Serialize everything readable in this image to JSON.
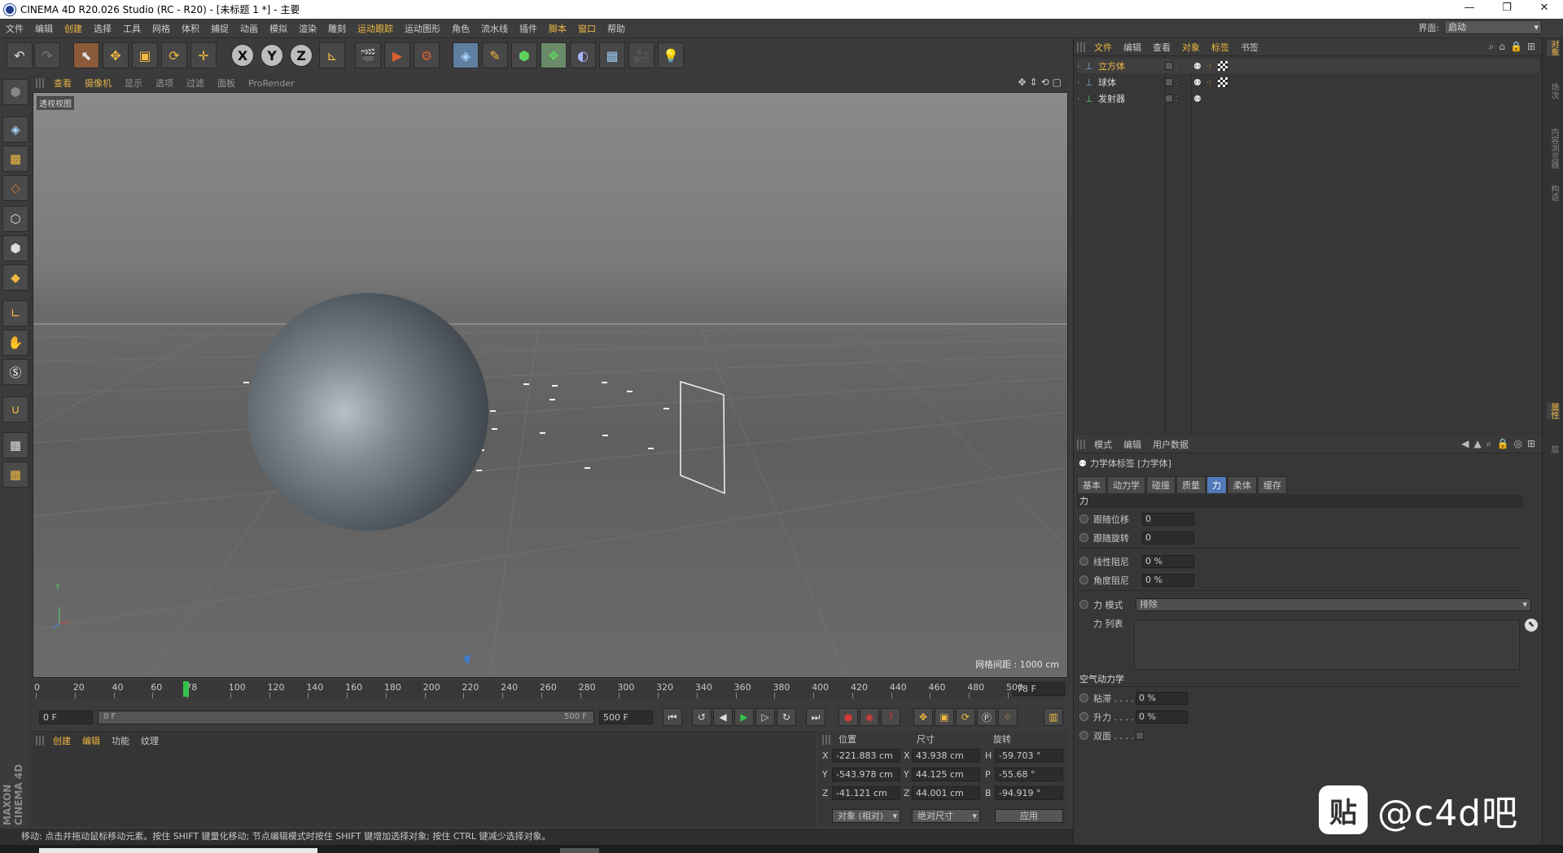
{
  "window": {
    "title": "CINEMA 4D R20.026 Studio (RC - R20) - [未标题 1 *] - 主要",
    "minimize_glyph": "—",
    "restore_glyph": "❐",
    "close_glyph": "✕"
  },
  "menubar": {
    "items": [
      "文件",
      "编辑",
      "创建",
      "选择",
      "工具",
      "网格",
      "体积",
      "捕捉",
      "动画",
      "模拟",
      "渲染",
      "雕刻",
      "运动跟踪",
      "运动图形",
      "角色",
      "流水线",
      "插件",
      "脚本",
      "窗口",
      "帮助"
    ],
    "layout_label": "界面:",
    "layout_value": "启动"
  },
  "toolbar": {
    "icons": [
      "undo-icon",
      "redo-icon",
      "select-icon",
      "move-icon",
      "scale-icon",
      "rotate-icon",
      "live-select-icon",
      "x-axis-icon",
      "y-axis-icon",
      "z-axis-icon",
      "coord-system-icon",
      "render-view-icon",
      "render-picture-queue-icon",
      "render-settings-icon",
      "cube-icon",
      "pen-icon",
      "subdivision-icon",
      "array-icon",
      "deformer-icon",
      "floor-icon",
      "camera-icon",
      "light-icon"
    ],
    "axes": [
      "X",
      "Y",
      "Z"
    ]
  },
  "left_tools": [
    "make-editable-icon",
    "model-mode-icon",
    "texture-mode-icon",
    "workplane-icon",
    "points-mode-icon",
    "edges-mode-icon",
    "polygons-mode-icon",
    "axis-mode-icon",
    "tweak-mode-icon",
    "solo-icon",
    "snap-icon",
    "workplane-lock-icon",
    "layer-icon"
  ],
  "viewport": {
    "menu": [
      "查看",
      "摄像机",
      "显示",
      "选项",
      "过滤",
      "面板",
      "ProRender"
    ],
    "active_menu": [
      "查看",
      "摄像机"
    ],
    "view_label": "透视视图",
    "grid_info": "网格间距 : 1000 cm",
    "axis_y": "Y",
    "nav_icons": [
      "move-view-icon",
      "zoom-view-icon",
      "rotate-view-icon",
      "toggle-view-icon"
    ]
  },
  "timeline": {
    "ticks": [
      "0",
      "20",
      "40",
      "60",
      "78",
      "100",
      "120",
      "140",
      "160",
      "180",
      "200",
      "220",
      "240",
      "260",
      "280",
      "300",
      "320",
      "340",
      "360",
      "380",
      "400",
      "420",
      "440",
      "460",
      "480",
      "500"
    ],
    "current_frame": "78 F",
    "current_frame_value": 78,
    "max_frame": 500
  },
  "playback": {
    "start": "0 F",
    "range_start": "0 F",
    "range_end": "500 F",
    "end": "500 F",
    "buttons": [
      "go-start-icon",
      "prev-key-icon",
      "prev-frame-icon",
      "play-icon",
      "next-frame-icon",
      "next-key-icon",
      "go-end-icon",
      "record-icon",
      "autokey-icon",
      "keyframe-selection-icon",
      "move-key-icon",
      "scale-key-icon",
      "rotate-key-icon",
      "param-key-icon",
      "pla-key-icon",
      "timeline-icon"
    ]
  },
  "materials": {
    "menu": [
      "创建",
      "编辑",
      "功能",
      "纹理"
    ]
  },
  "coords": {
    "headers": [
      "位置",
      "尺寸",
      "旋转"
    ],
    "rows": [
      {
        "axis": "X",
        "pos": "-221.883 cm",
        "size_axis": "X",
        "size": "43.938 cm",
        "rot_axis": "H",
        "rot": "-59.703 °"
      },
      {
        "axis": "Y",
        "pos": "-543.978 cm",
        "size_axis": "Y",
        "size": "44.125 cm",
        "rot_axis": "P",
        "rot": "-55.68 °"
      },
      {
        "axis": "Z",
        "pos": "-41.121 cm",
        "size_axis": "Z",
        "size": "44.001 cm",
        "rot_axis": "B",
        "rot": "-94.919 °"
      }
    ],
    "mode1": "对象 (相对)",
    "mode2": "绝对尺寸",
    "apply": "应用"
  },
  "status": "移动: 点击并拖动鼠标移动元素。按住 SHIFT 键量化移动; 节点编辑模式时按住 SHIFT 键增加选择对象; 按住 CTRL 键减少选择对象。",
  "maxon_logo": "MAXON CINEMA 4D",
  "object_manager": {
    "menu": [
      "文件",
      "编辑",
      "查看",
      "对象",
      "标签",
      "书签"
    ],
    "active_menu": [
      "文件",
      "对象",
      "标签"
    ],
    "objects": [
      {
        "name": "立方体",
        "selected": true
      },
      {
        "name": "球体",
        "selected": false
      },
      {
        "name": "发射器",
        "selected": false
      }
    ]
  },
  "attribute_manager": {
    "menu": [
      "模式",
      "编辑",
      "用户数据"
    ],
    "tag_title": "力学体标签 [力学体]",
    "tabs": [
      "基本",
      "动力学",
      "碰撞",
      "质量",
      "力",
      "柔体",
      "缓存"
    ],
    "active_tab": "力",
    "section_force": "力",
    "follow_pos_label": "跟随位移",
    "follow_pos": "0",
    "follow_rot_label": "跟随旋转",
    "follow_rot": "0",
    "lin_damp_label": "线性阻尼",
    "lin_damp": "0 %",
    "ang_damp_label": "角度阻尼",
    "ang_damp": "0 %",
    "force_mode_label": "力 模式",
    "force_mode": "排除",
    "force_list_label": "力 列表",
    "section_aero": "空气动力学",
    "drag_label": "粘滞 . . . .",
    "drag": "0 %",
    "lift_label": "升力 . . . .",
    "lift": "0 %",
    "twosided_label": "双面 . . . ."
  },
  "right_tabs": [
    "对象",
    "场次",
    "内容浏览器",
    "构造",
    "属性",
    "层"
  ],
  "watermark": {
    "badge": "贴",
    "text": "@c4d吧"
  },
  "colors": {
    "accent": "#f0b840",
    "selected_tab": "#5279b8",
    "play_green": "#36c24a",
    "record_red": "#d23a3a"
  }
}
